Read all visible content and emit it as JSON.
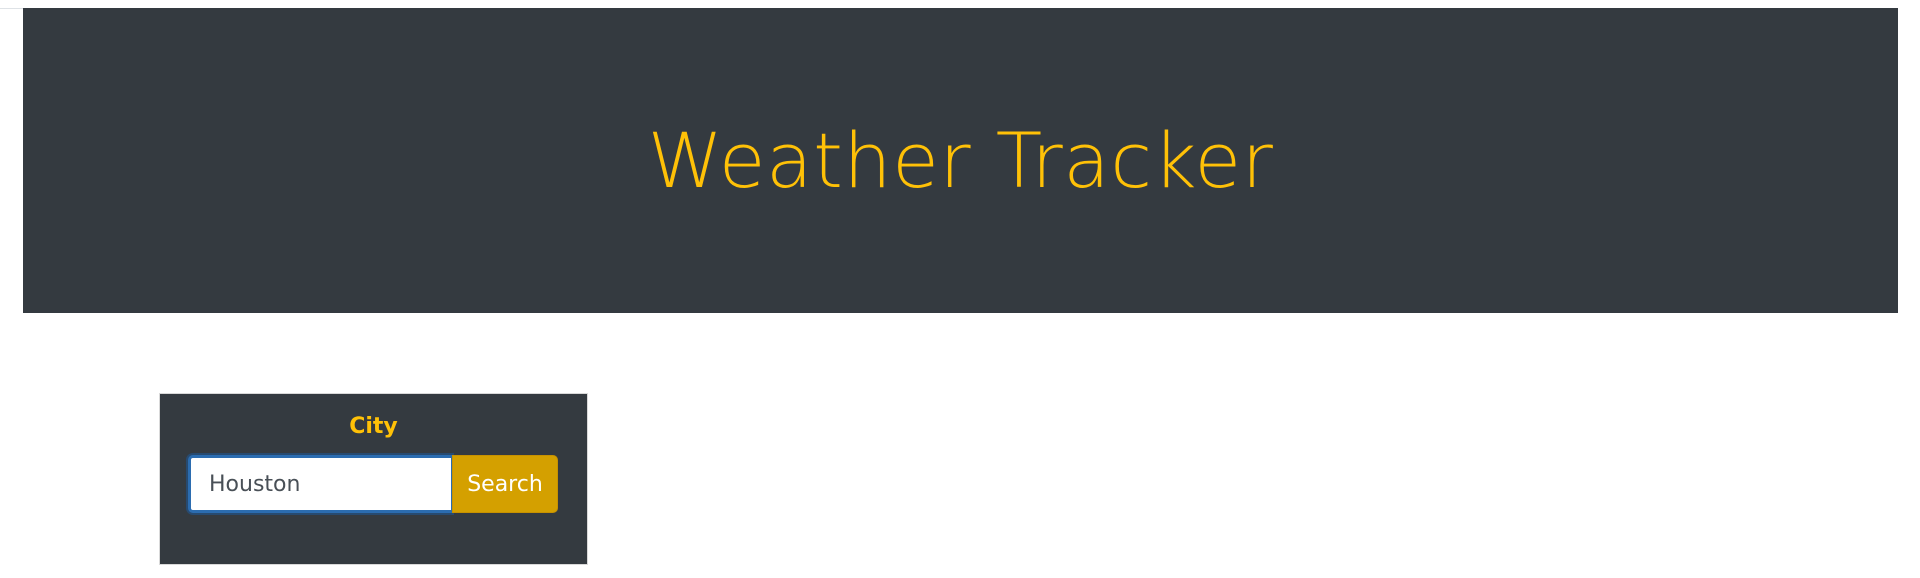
{
  "header": {
    "title": "Weather Tracker"
  },
  "search": {
    "label": "City",
    "input_value": "Houston",
    "button_label": "Search"
  },
  "colors": {
    "header_bg": "#343a40",
    "accent": "#ffc107",
    "button_bg": "#d4a000",
    "input_border": "#2b6cb0"
  }
}
